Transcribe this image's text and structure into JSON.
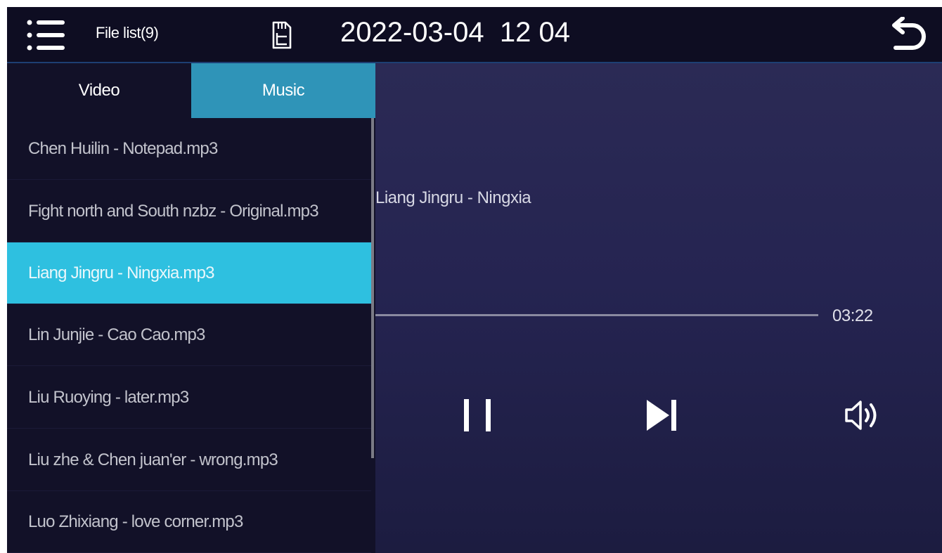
{
  "header": {
    "file_list": "File list(9)",
    "datetime": "2022-03-04  12 04",
    "icons": {
      "menu": "menu-icon",
      "sd": "sd-card-icon",
      "back": "back-icon"
    }
  },
  "tabs": [
    {
      "label": "Video",
      "active": false
    },
    {
      "label": "Music",
      "active": true
    }
  ],
  "files": [
    {
      "name": "Chen Huilin - Notepad.mp3"
    },
    {
      "name": "Fight north and South nzbz - Original.mp3"
    },
    {
      "name": "Liang Jingru - Ningxia.mp3",
      "active": true
    },
    {
      "name": "Lin Junjie - Cao Cao.mp3"
    },
    {
      "name": "Liu Ruoying - later.mp3"
    },
    {
      "name": "Liu zhe & Chen juan'er - wrong.mp3"
    },
    {
      "name": "Luo Zhixiang - love corner.mp3"
    }
  ],
  "player": {
    "title": "Liang Jingru - Ningxia",
    "time": "03:22",
    "controls": {
      "pause": "pause-icon",
      "next": "next-track-icon",
      "volume": "volume-icon"
    }
  },
  "colors": {
    "accent": "#2ec0e0",
    "tab_active": "#2f94b8",
    "header_bg": "#0e0d22",
    "list_bg": "#121128"
  }
}
